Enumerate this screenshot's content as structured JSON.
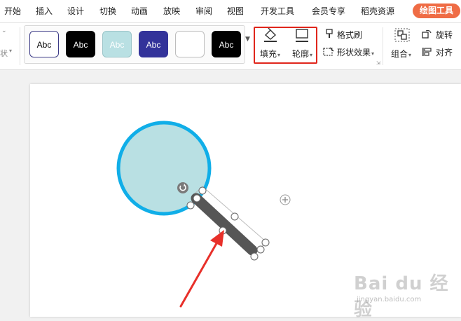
{
  "menu": {
    "items": [
      "开始",
      "插入",
      "设计",
      "切换",
      "动画",
      "放映",
      "审阅",
      "视图",
      "开发工具",
      "会员专享",
      "稻壳资源"
    ],
    "active_tab": "绘图工具"
  },
  "ribbon": {
    "left_clip_label": "状",
    "style_gallery": [
      {
        "text": "Abc",
        "bg": "#ffffff",
        "fg": "#000000",
        "border": "#3b3a86"
      },
      {
        "text": "Abc",
        "bg": "#000000",
        "fg": "#ffffff",
        "border": "#000000"
      },
      {
        "text": "Abc",
        "bg": "#b9e0e3",
        "fg": "#ffffff",
        "border": "#9ac4c8"
      },
      {
        "text": "Abc",
        "bg": "#33339a",
        "fg": "#ffffff",
        "border": "#33339a"
      },
      {
        "text": "",
        "bg": "#ffffff",
        "fg": "#000000",
        "border": "#bdbdbd"
      },
      {
        "text": "Abc",
        "bg": "#000000",
        "fg": "#ffffff",
        "border": "#000000"
      }
    ],
    "fill_label": "填充",
    "outline_label": "轮廓",
    "format_painter_label": "格式刷",
    "shape_effects_label": "形状效果",
    "group_label": "组合",
    "rotate_label": "旋转",
    "align_label": "对齐"
  },
  "canvas": {
    "circle_fill": "#b9e0e3",
    "circle_stroke": "#10aee8",
    "handle_fill": "#565656",
    "arrow_color": "#e8302a",
    "highlight_color": "#e0261c"
  },
  "watermark": {
    "brand": "Bai du 经验",
    "url": "jingyan.baidu.com"
  }
}
